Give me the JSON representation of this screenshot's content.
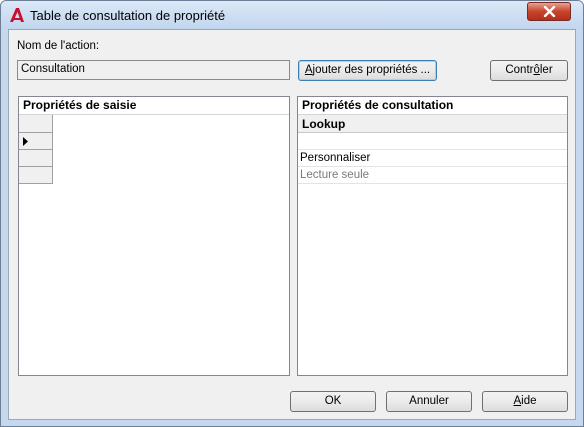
{
  "window": {
    "title": "Table de consultation de propriété"
  },
  "action": {
    "label": "Nom de l'action:",
    "value": "Consultation"
  },
  "buttons": {
    "add_properties": {
      "before": "",
      "underlined": "A",
      "after": "jouter des propriétés ..."
    },
    "check": {
      "before": "Contr",
      "underlined": "ô",
      "after": "ler"
    },
    "ok": "OK",
    "cancel": "Annuler",
    "help": {
      "before": "",
      "underlined": "A",
      "after": "ide"
    }
  },
  "input_panel": {
    "title": "Propriétés de saisie"
  },
  "lookup_panel": {
    "title": "Propriétés de consultation",
    "column": "Lookup",
    "rows": [
      "",
      "Personnaliser",
      "Lecture seule"
    ]
  },
  "icons": {
    "app": "autocad-logo-icon",
    "close": "close-icon",
    "current_row": "row-pointer-icon"
  },
  "colors": {
    "close_red": "#c7432c",
    "titlebar": "#c6d8ee",
    "read_only_text": "#7a7a7a"
  }
}
